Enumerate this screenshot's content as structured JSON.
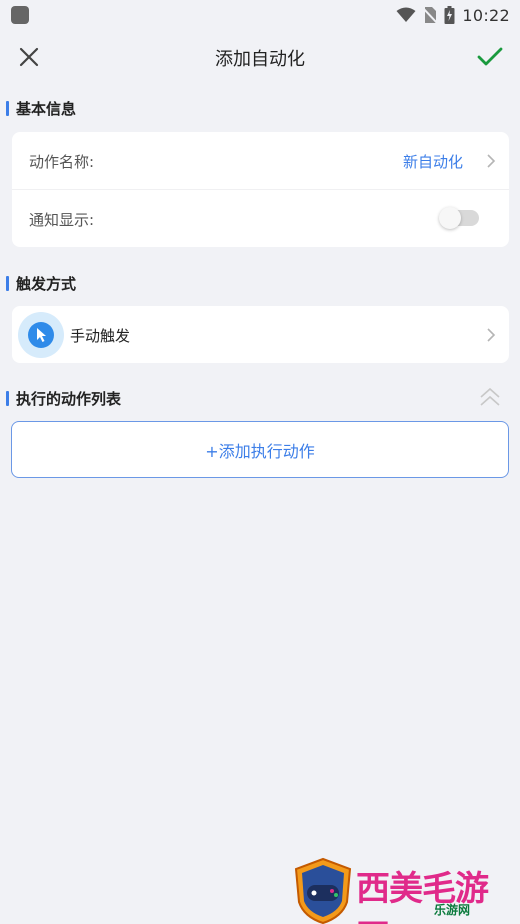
{
  "status_bar": {
    "time": "10:22",
    "icons": [
      "wifi-icon",
      "no-sim-icon",
      "battery-icon"
    ]
  },
  "header": {
    "title": "添加自动化",
    "close_icon": "close-icon",
    "confirm_icon": "check-icon",
    "confirm_color": "#1a9a3e"
  },
  "sections": {
    "basic": {
      "title": "基本信息",
      "name_row": {
        "label": "动作名称:",
        "value": "新自动化"
      },
      "notify_row": {
        "label": "通知显示:",
        "toggle_on": false
      }
    },
    "trigger": {
      "title": "触发方式",
      "item": {
        "label": "手动触发",
        "icon": "cursor-icon"
      }
    },
    "actions": {
      "title": "执行的动作列表",
      "add_button": "+添加执行动作",
      "collapse_icon": "double-chevron-up-icon"
    }
  },
  "watermark": {
    "text": "西美毛游网",
    "sub": "乐游网"
  },
  "colors": {
    "accent": "#3c7ee8",
    "background": "#f1f2f6",
    "card": "#ffffff"
  }
}
